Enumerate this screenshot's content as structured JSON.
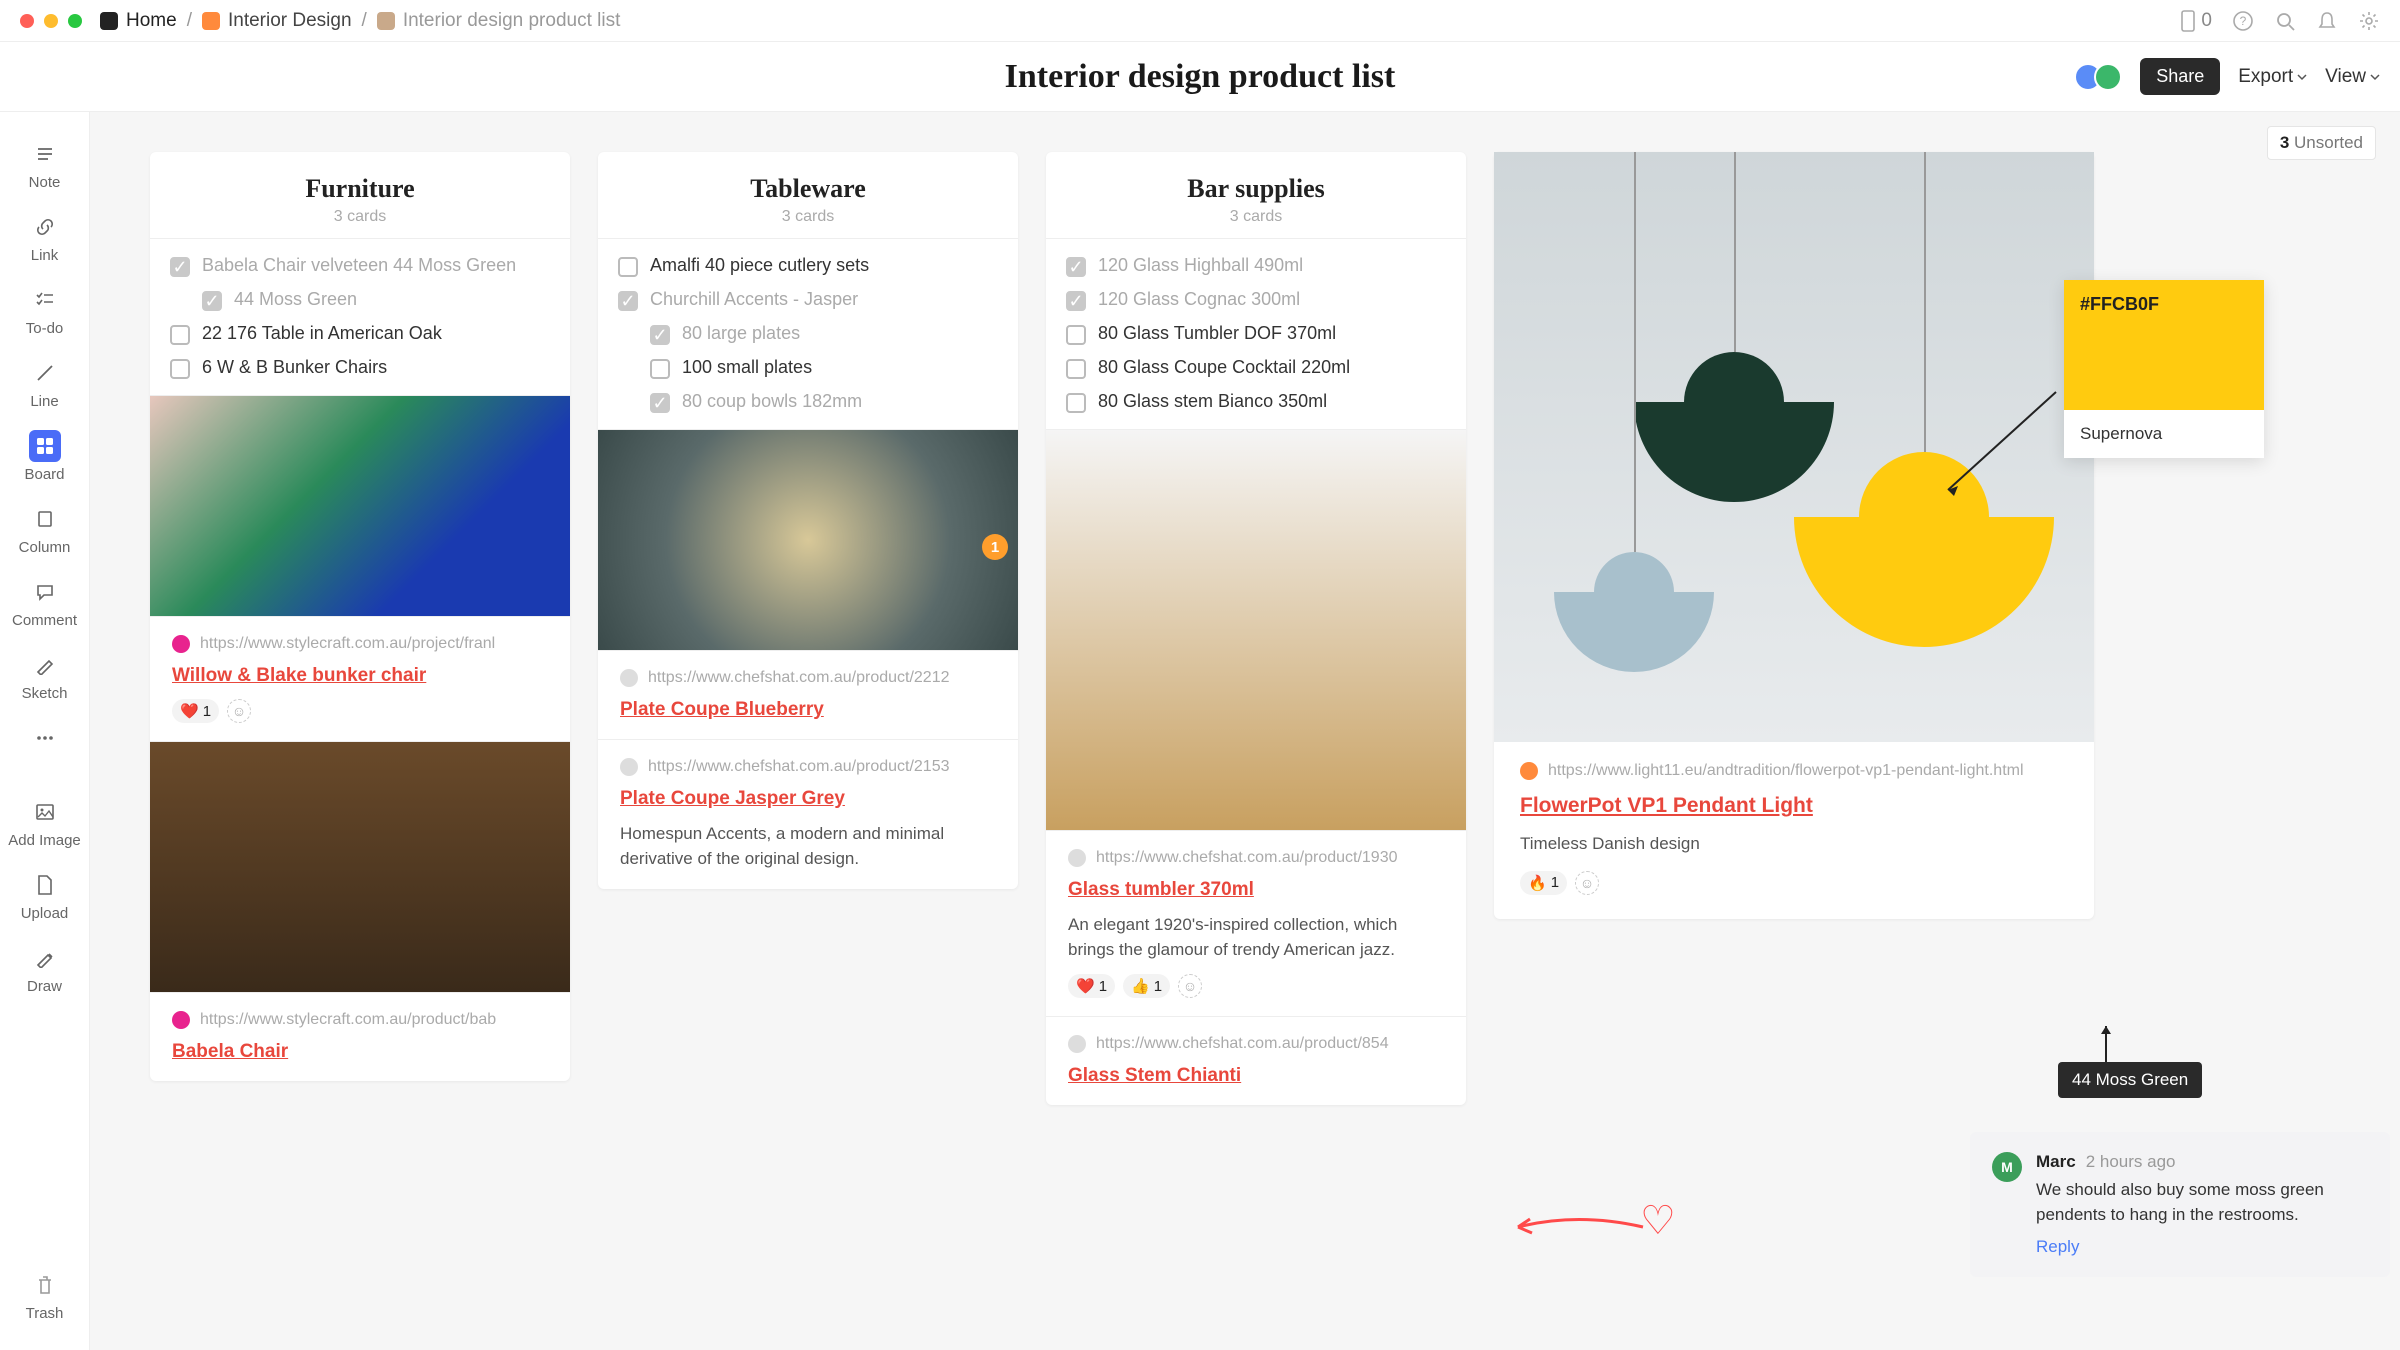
{
  "breadcrumbs": {
    "home": "Home",
    "mid": "Interior Design",
    "leaf": "Interior design product list"
  },
  "topbar": {
    "device_count": "0"
  },
  "page": {
    "title": "Interior design product list",
    "share": "Share",
    "export": "Export",
    "view": "View"
  },
  "unsorted": {
    "count": "3",
    "label": "Unsorted"
  },
  "rail": [
    {
      "k": "note",
      "label": "Note"
    },
    {
      "k": "link",
      "label": "Link"
    },
    {
      "k": "todo",
      "label": "To-do"
    },
    {
      "k": "line",
      "label": "Line"
    },
    {
      "k": "board",
      "label": "Board"
    },
    {
      "k": "column",
      "label": "Column"
    },
    {
      "k": "comment",
      "label": "Comment"
    },
    {
      "k": "sketch",
      "label": "Sketch"
    },
    {
      "k": "more",
      "label": ""
    },
    {
      "k": "addimage",
      "label": "Add Image"
    },
    {
      "k": "upload",
      "label": "Upload"
    },
    {
      "k": "draw",
      "label": "Draw"
    }
  ],
  "trash": "Trash",
  "columns": [
    {
      "title": "Furniture",
      "sub": "3 cards",
      "todos": [
        {
          "text": "Babela Chair velveteen 44 Moss Green",
          "done": true
        },
        {
          "text": "44 Moss Green",
          "done": true,
          "sub": true
        },
        {
          "text": "22 176 Table in American Oak",
          "done": false
        },
        {
          "text": "6 W & B Bunker Chairs",
          "done": false
        }
      ],
      "links": [
        {
          "url": "https://www.stylecraft.com.au/project/franl",
          "title": "Willow & Blake bunker chair",
          "fav": "#e8238e",
          "reacts": [
            {
              "e": "❤️",
              "n": "1"
            }
          ]
        },
        {
          "url": "https://www.stylecraft.com.au/product/bab",
          "title": "Babela Chair",
          "fav": "#e8238e"
        }
      ],
      "img_between": true
    },
    {
      "title": "Tableware",
      "sub": "3 cards",
      "todos": [
        {
          "text": "Amalfi 40 piece cutlery sets",
          "done": false
        },
        {
          "text": "Churchill Accents - Jasper",
          "done": true
        },
        {
          "text": "80 large plates",
          "done": true,
          "sub": true
        },
        {
          "text": "100 small plates",
          "done": false,
          "sub": true
        },
        {
          "text": "80 coup bowls 182mm",
          "done": true,
          "sub": true
        }
      ],
      "badge": "1",
      "links": [
        {
          "url": "https://www.chefshat.com.au/product/2212",
          "title": "Plate Coupe Blueberry",
          "fav": "icon"
        },
        {
          "url": "https://www.chefshat.com.au/product/2153",
          "title": "Plate Coupe Jasper Grey",
          "fav": "icon",
          "desc": "Homespun Accents, a modern and minimal derivative of the original design."
        }
      ]
    },
    {
      "title": "Bar supplies",
      "sub": "3 cards",
      "todos": [
        {
          "text": "120 Glass Highball 490ml",
          "done": true
        },
        {
          "text": "120 Glass Cognac 300ml",
          "done": true
        },
        {
          "text": "80 Glass Tumbler DOF 370ml",
          "done": false
        },
        {
          "text": "80 Glass Coupe Cocktail 220ml",
          "done": false
        },
        {
          "text": "80 Glass stem Bianco 350ml",
          "done": false
        }
      ],
      "links": [
        {
          "url": "https://www.chefshat.com.au/product/1930",
          "title": "Glass tumbler 370ml",
          "fav": "icon",
          "desc": "An elegant 1920's-inspired collection, which brings the glamour of trendy American jazz.",
          "reacts": [
            {
              "e": "❤️",
              "n": "1"
            },
            {
              "e": "👍",
              "n": "1"
            }
          ]
        },
        {
          "url": "https://www.chefshat.com.au/product/854",
          "title": "Glass Stem Chianti",
          "fav": "icon"
        }
      ]
    }
  ],
  "detail": {
    "url": "https://www.light11.eu/andtradition/flowerpot-vp1-pendant-light.html",
    "title": "FlowerPot VP1 Pendant Light",
    "desc": "Timeless Danish design",
    "reacts": [
      {
        "e": "🔥",
        "n": "1"
      }
    ],
    "swatch": {
      "hex": "#FFCB0F",
      "name": "Supernova"
    }
  },
  "tag": "44 Moss Green",
  "comment": {
    "name": "Marc",
    "time": "2 hours ago",
    "text": "We should also buy some moss green pendents to hang in the restrooms.",
    "reply": "Reply"
  }
}
